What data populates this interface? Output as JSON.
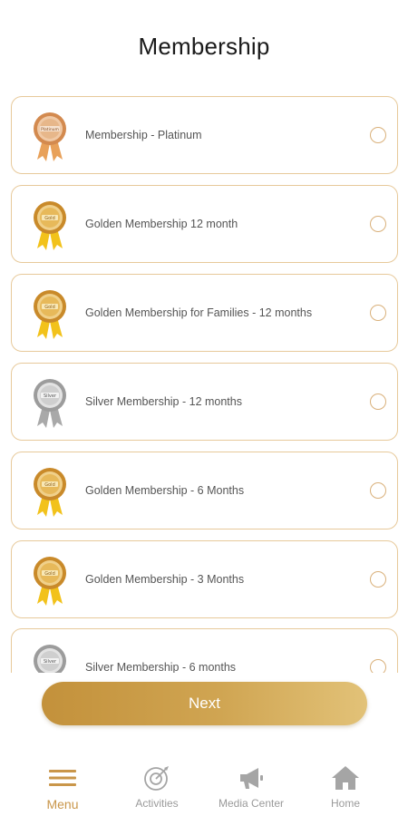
{
  "header": {
    "title": "Membership"
  },
  "memberships": [
    {
      "label": "Membership - Platinum",
      "tier": "platinum",
      "badge_text": "Platinum"
    },
    {
      "label": "Golden Membership 12 month",
      "tier": "gold",
      "badge_text": "Gold"
    },
    {
      "label": "Golden Membership for Families - 12 months",
      "tier": "gold",
      "badge_text": "Gold"
    },
    {
      "label": "Silver Membership - 12 months",
      "tier": "silver",
      "badge_text": "Silver"
    },
    {
      "label": "Golden Membership - 6 Months",
      "tier": "gold",
      "badge_text": "Gold"
    },
    {
      "label": "Golden Membership - 3 Months",
      "tier": "gold",
      "badge_text": "Gold"
    },
    {
      "label": "Silver Membership - 6 months",
      "tier": "silver",
      "badge_text": "Silver"
    }
  ],
  "next_button": {
    "label": "Next"
  },
  "tabbar": {
    "menu": {
      "label": "Menu",
      "icon": "menu-icon"
    },
    "activities": {
      "label": "Activities",
      "icon": "target-icon"
    },
    "media_center": {
      "label": "Media Center",
      "icon": "megaphone-icon"
    },
    "home": {
      "label": "Home",
      "icon": "home-icon"
    }
  },
  "colors": {
    "accent": "#c9964a",
    "card_border": "#e7c99a",
    "platinum": "#d9955a",
    "gold": "#e0a23a",
    "silver": "#b8b8b8",
    "ribbon_gold": "#f2c21b"
  }
}
